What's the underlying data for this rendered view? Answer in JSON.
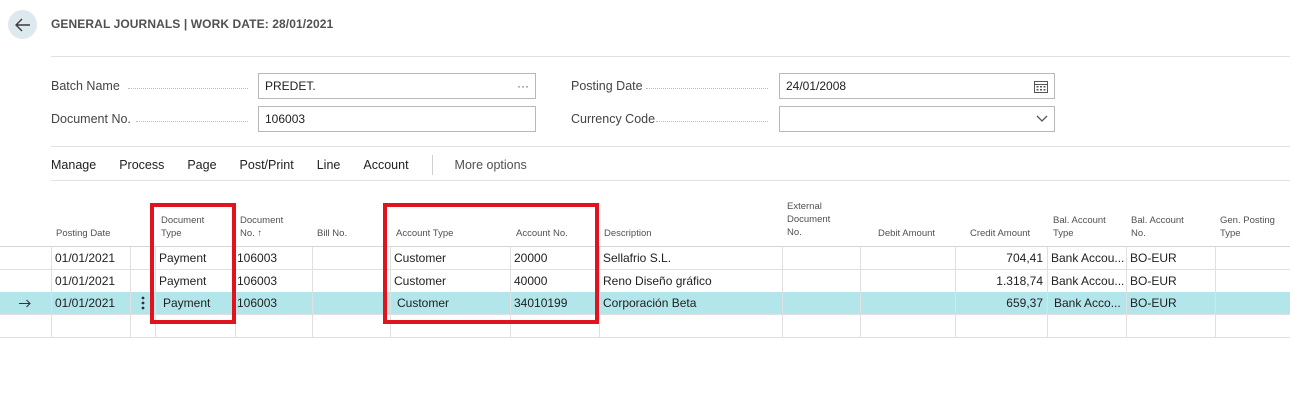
{
  "header": {
    "title": "GENERAL JOURNALS | WORK DATE: 28/01/2021",
    "back_icon": "arrow-left-icon"
  },
  "form": {
    "batch_name_label": "Batch Name",
    "batch_name_value": "PREDET.",
    "document_no_label": "Document No.",
    "document_no_value": "106003",
    "posting_date_label": "Posting Date",
    "posting_date_value": "24/01/2008",
    "currency_code_label": "Currency Code",
    "currency_code_value": ""
  },
  "actions": {
    "manage": "Manage",
    "process": "Process",
    "page": "Page",
    "post_print": "Post/Print",
    "line": "Line",
    "account": "Account",
    "more": "More options"
  },
  "columns": {
    "posting_date": "Posting Date",
    "document_type_1": "Document",
    "document_type_2": "Type",
    "document_no_1": "Document",
    "document_no_2": "No. ↑",
    "bill_no": "Bill No.",
    "account_type": "Account Type",
    "account_no": "Account No.",
    "description": "Description",
    "external_1": "External",
    "external_2": "Document",
    "external_3": "No.",
    "debit_amount": "Debit Amount",
    "credit_amount": "Credit Amount",
    "bal_account_type_1": "Bal. Account",
    "bal_account_type_2": "Type",
    "bal_account_no_1": "Bal. Account",
    "bal_account_no_2": "No.",
    "gen_posting_type_1": "Gen. Posting",
    "gen_posting_type_2": "Type"
  },
  "rows": [
    {
      "posting_date": "01/01/2021",
      "document_type": "Payment",
      "document_no": "106003",
      "account_type": "Customer",
      "account_no": "20000",
      "description": "Sellafrio S.L.",
      "credit_amount": "704,41",
      "bal_account_type": "Bank Accou...",
      "bal_account_no": "BO-EUR"
    },
    {
      "posting_date": "01/01/2021",
      "document_type": "Payment",
      "document_no": "106003",
      "account_type": "Customer",
      "account_no": "40000",
      "description": "Reno Diseño gráfico",
      "credit_amount": "1.318,74",
      "bal_account_type": "Bank Accou...",
      "bal_account_no": "BO-EUR"
    },
    {
      "posting_date": "01/01/2021",
      "document_type": "Payment",
      "document_no": "106003",
      "account_type": "Customer",
      "account_no": "34010199",
      "description": "Corporación Beta",
      "credit_amount": "659,37",
      "bal_account_type": "Bank Acco...",
      "bal_account_no": "BO-EUR"
    }
  ],
  "colors": {
    "selected_row": "#b2e6ea",
    "highlight_box": "#e0141e"
  }
}
